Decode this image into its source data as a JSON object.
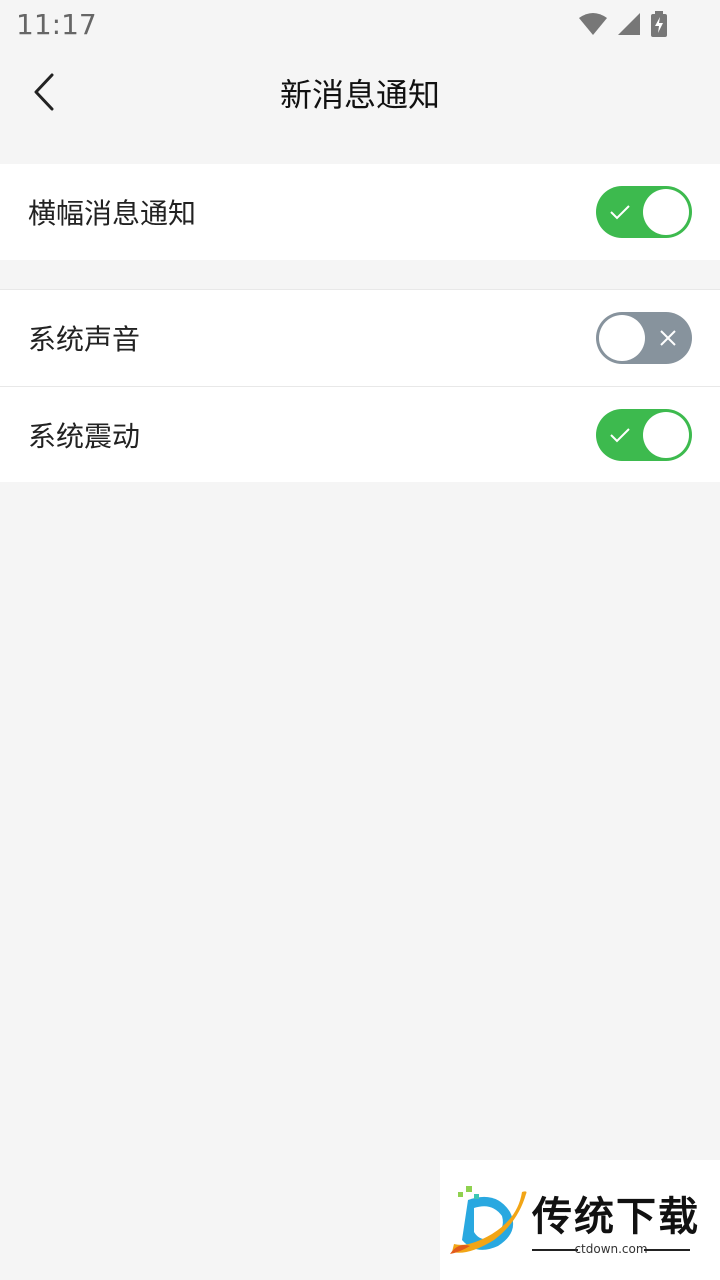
{
  "status_bar": {
    "time": "11:17"
  },
  "header": {
    "title": "新消息通知",
    "back_icon": "chevron-left-icon"
  },
  "settings": {
    "banner_notification": {
      "label": "横幅消息通知",
      "enabled": true
    },
    "system_sound": {
      "label": "系统声音",
      "enabled": false
    },
    "system_vibration": {
      "label": "系统震动",
      "enabled": true
    }
  },
  "watermark": {
    "brand": "传统下载",
    "url": "ctdown.com"
  },
  "colors": {
    "toggle_on": "#3dba4e",
    "toggle_off": "#87939d",
    "background": "#f5f5f5"
  }
}
